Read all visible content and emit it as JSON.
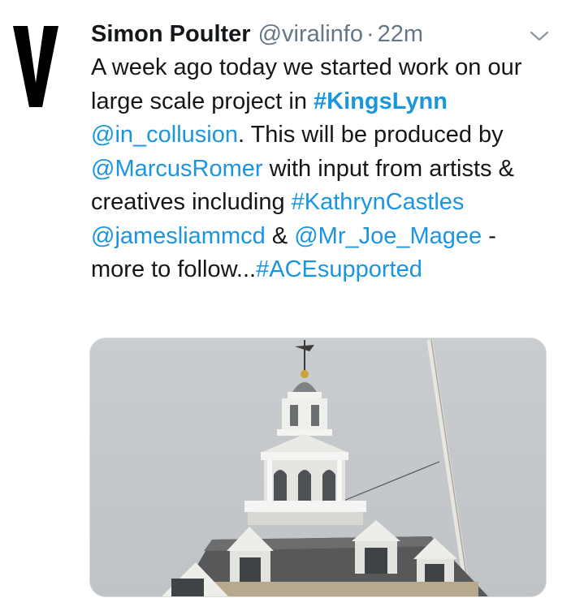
{
  "tweet": {
    "display_name": "Simon Poulter",
    "handle": "@viralinfo",
    "separator": "·",
    "time": "22m",
    "text": {
      "line1": "A week ago today we started work on our large scale project in ",
      "hashtag_kingslynn": "#KingsLynn",
      "mention_collusion": "@in_collusion",
      "t2": ". This will be produced by ",
      "mention_marcus": "@MarcusRomer",
      "t3": " with input from artists & creatives including ",
      "hashtag_kathryn": "#KathrynCastles",
      "t4": " ",
      "mention_james": "@jamesliammcd",
      "t5": " & ",
      "mention_joe": "@Mr_Joe_Magee",
      "t6": " - more to follow...",
      "hashtag_ace": "#ACEsupported"
    }
  },
  "icons": {
    "avatar": "V-logo-avatar",
    "menu": "chevron-down-icon"
  },
  "colors": {
    "link": "#1b95e0",
    "meta": "#657786",
    "text": "#14171a"
  }
}
